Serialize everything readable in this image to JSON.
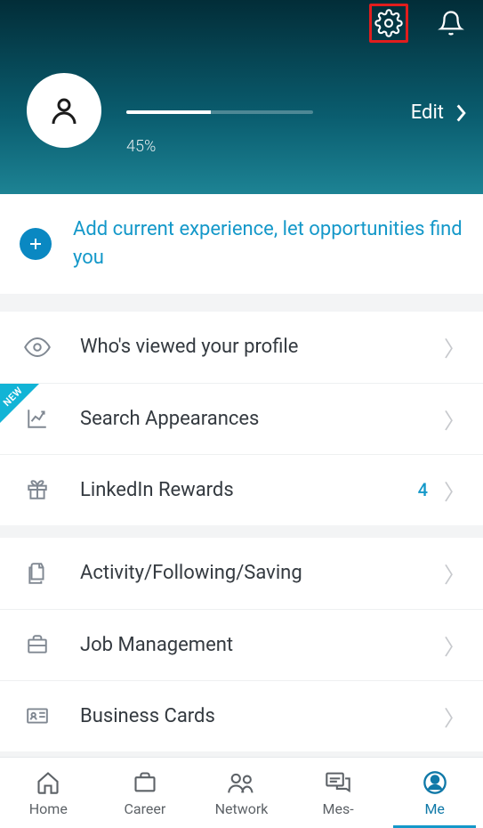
{
  "header": {
    "progress_pct": "45%",
    "progress_fill": 45,
    "edit_label": "Edit"
  },
  "add_experience": {
    "text": "Add current experience, let opportunities find you"
  },
  "group1": [
    {
      "icon": "eye",
      "label": "Who's viewed your profile",
      "value": "",
      "badge": ""
    },
    {
      "icon": "chart",
      "label": "Search Appearances",
      "value": "",
      "badge": "NEW"
    },
    {
      "icon": "gift",
      "label": "LinkedIn Rewards",
      "value": "4",
      "badge": ""
    }
  ],
  "group2": [
    {
      "icon": "docs",
      "label": "Activity/Following/Saving",
      "value": ""
    },
    {
      "icon": "briefcase",
      "label": "Job Management",
      "value": ""
    },
    {
      "icon": "card",
      "label": "Business Cards",
      "value": ""
    }
  ],
  "tabs": [
    {
      "label": "Home",
      "icon": "home",
      "active": false
    },
    {
      "label": "Career",
      "icon": "briefcase",
      "active": false
    },
    {
      "label": "Network",
      "icon": "network",
      "active": false
    },
    {
      "label": "Mes-",
      "icon": "messages",
      "active": false
    },
    {
      "label": "Me",
      "icon": "me",
      "active": true
    }
  ],
  "colors": {
    "accent": "#1498c9",
    "highlight": "#e11d1d"
  }
}
